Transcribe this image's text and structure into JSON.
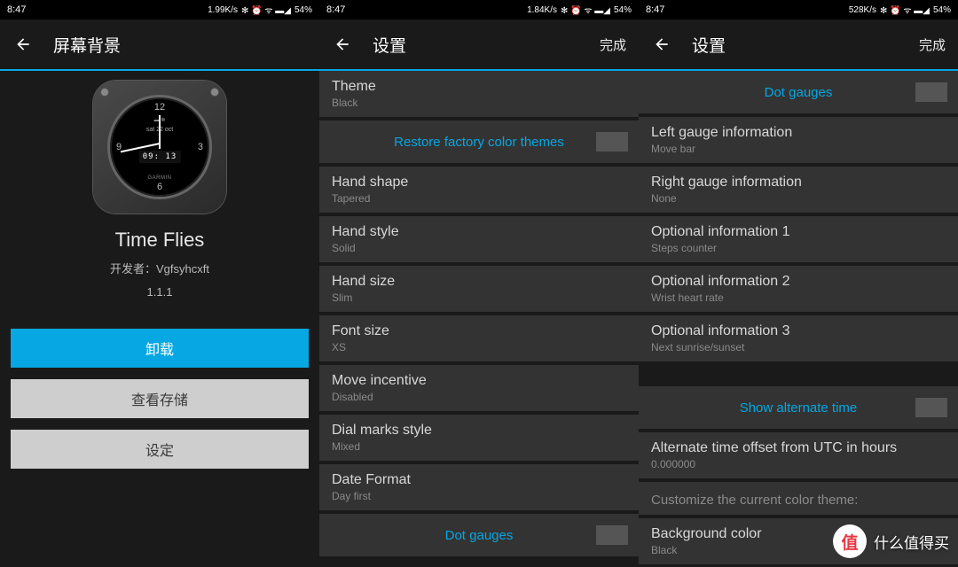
{
  "statusbar": {
    "time": "8:47",
    "rate1": "1.99K/s",
    "rate2": "1.84K/s",
    "rate3": "528K/s",
    "battery": "54%",
    "icons": "✻ ⏰ ᯤ ▬◢"
  },
  "screen1": {
    "title": "屏幕背景",
    "watch": {
      "day": "sat 22 oct",
      "time": "09: 13",
      "brand": "GARMIN",
      "n12": "12",
      "n3": "3",
      "n6": "6",
      "n9": "9"
    },
    "app_name": "Time Flies",
    "dev_label": "开发者：",
    "dev_name": "Vgfsyhcxft",
    "version": "1.1.1",
    "btn_uninstall": "卸载",
    "btn_storage": "查看存储",
    "btn_settings": "设定"
  },
  "screen2": {
    "title": "设置",
    "done": "完成",
    "items": [
      {
        "title": "Theme",
        "value": "Black"
      },
      {
        "title": "Restore factory color themes",
        "link": true,
        "toggle": true
      },
      {
        "title": "Hand shape",
        "value": "Tapered"
      },
      {
        "title": "Hand style",
        "value": "Solid"
      },
      {
        "title": "Hand size",
        "value": "Slim"
      },
      {
        "title": "Font size",
        "value": "XS"
      },
      {
        "title": "Move incentive",
        "value": "Disabled"
      },
      {
        "title": "Dial marks style",
        "value": "Mixed"
      },
      {
        "title": "Date Format",
        "value": "Day first"
      },
      {
        "title": "Dot gauges",
        "link": true,
        "toggle": true
      }
    ]
  },
  "screen3": {
    "title": "设置",
    "done": "完成",
    "items": [
      {
        "title": "Dot gauges",
        "link": true,
        "toggle": true
      },
      {
        "title": "Left gauge information",
        "value": "Move bar"
      },
      {
        "title": "Right gauge information",
        "value": "None"
      },
      {
        "title": "Optional information 1",
        "value": "Steps counter"
      },
      {
        "title": "Optional information 2",
        "value": "Wrist heart rate"
      },
      {
        "title": "Optional information 3",
        "value": "Next sunrise/sunset"
      },
      {
        "title": "Show alternate time",
        "link": true,
        "toggle": true,
        "spacer": true
      },
      {
        "title": "Alternate time offset from UTC in hours",
        "value": "0.000000"
      },
      {
        "section": "Customize the current color theme:"
      },
      {
        "title": "Background color",
        "value": "Black"
      }
    ]
  },
  "watermark": {
    "badge": "值",
    "text": "什么值得买"
  }
}
